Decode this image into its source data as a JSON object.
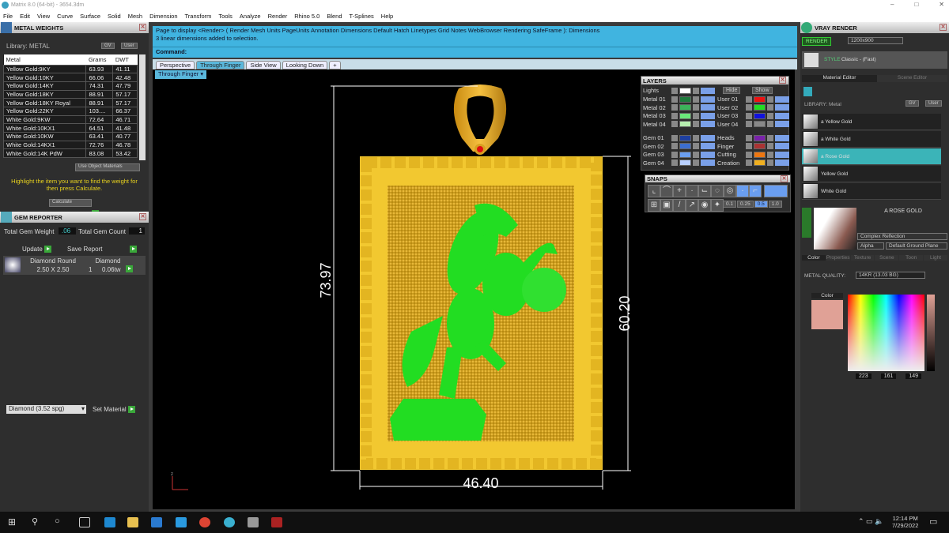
{
  "window": {
    "title": "Matrix 8.0 (64-bit) - 3654.3dm",
    "controls": [
      "–",
      "□",
      "✕"
    ]
  },
  "menu": [
    "File",
    "Edit",
    "View",
    "Curve",
    "Surface",
    "Solid",
    "Mesh",
    "Dimension",
    "Transform",
    "Tools",
    "Analyze",
    "Render",
    "Rhino 5.0",
    "Blend",
    "T-Splines",
    "Help"
  ],
  "metal_weights": {
    "title": "METAL WEIGHTS",
    "library_label": "Library: METAL",
    "gv": "GV",
    "user": "User",
    "columns": [
      "Metal",
      "Grams",
      "DWT"
    ],
    "rows": [
      [
        "Yellow Gold:9KY",
        "63.93",
        "41.11"
      ],
      [
        "Yellow Gold:10KY",
        "66.06",
        "42.48"
      ],
      [
        "Yellow Gold:14KY",
        "74.31",
        "47.79"
      ],
      [
        "Yellow Gold:18KY",
        "88.91",
        "57.17"
      ],
      [
        "Yellow Gold:18KY Royal",
        "88.91",
        "57.17"
      ],
      [
        "Yellow Gold:22KY",
        "103....",
        "66.37"
      ],
      [
        "White Gold:9KW",
        "72.64",
        "46.71"
      ],
      [
        "White Gold:10KX1",
        "64.51",
        "41.48"
      ],
      [
        "White Gold:10KW",
        "63.41",
        "40.77"
      ],
      [
        "White Gold:14KX1",
        "72.76",
        "46.78"
      ],
      [
        "White Gold:14K PdW",
        "83.08",
        "53.42"
      ]
    ],
    "use_object_materials": "Use Object Materials",
    "hint": "Highlight the item you want to find the weight for then press Calculate.",
    "calculate": "Calculate"
  },
  "gem_reporter": {
    "title": "GEM REPORTER",
    "total_weight_label": "Total Gem Weight",
    "total_weight": ".06",
    "total_count_label": "Total Gem Count",
    "total_count": "1",
    "update": "Update",
    "save_report": "Save Report",
    "gem": {
      "shape": "Diamond Round",
      "material": "Diamond",
      "size": "2.50 X 2.50",
      "count": "1",
      "weight": "0.06tw"
    },
    "material_select": "Diamond    (3.52 spg)",
    "set_material": "Set Material"
  },
  "command": {
    "history": [
      "Page to display <Render> ( Render  Mesh  Units  PageUnits  Annotation  Dimensions  Default  Hatch  Linetypes  Grid  Notes  WebBrowser  Rendering  SafeFrame ): Dimensions",
      "3 linear dimensions added to selection."
    ],
    "prompt": "Command:",
    "value": ""
  },
  "viewport_tabs": [
    {
      "label": "Perspective",
      "active": false
    },
    {
      "label": "Through Finger",
      "active": true
    },
    {
      "label": "Side View",
      "active": false
    },
    {
      "label": "Looking Down",
      "active": false
    },
    {
      "label": "+",
      "active": false
    }
  ],
  "viewport": {
    "name": "Through Finger",
    "dimensions": {
      "overall_height": "73.97",
      "body_height": "60.20",
      "width": "46.40"
    },
    "axis_label": "z"
  },
  "layers": {
    "title": "LAYERS",
    "lights": "Lights",
    "hide": "Hide",
    "show": "Show",
    "left": [
      {
        "name": "Metal 01",
        "color": "#1f7a3c"
      },
      {
        "name": "Metal 02",
        "color": "#3cb35a"
      },
      {
        "name": "Metal 03",
        "color": "#6ae87a"
      },
      {
        "name": "Metal 04",
        "color": "#b8f0b0"
      },
      {
        "name": "Gem 01",
        "color": "#1e3fa0"
      },
      {
        "name": "Gem 02",
        "color": "#3c6ed0"
      },
      {
        "name": "Gem 03",
        "color": "#6a9ef0"
      },
      {
        "name": "Gem 04",
        "color": "#b8d0ff"
      }
    ],
    "right": [
      {
        "name": "User 01",
        "color": "#ee1111"
      },
      {
        "name": "User 02",
        "color": "#22dd22"
      },
      {
        "name": "User 03",
        "color": "#1111dd"
      },
      {
        "name": "User 04",
        "color": "#888888"
      },
      {
        "name": "Heads",
        "color": "#7a22aa"
      },
      {
        "name": "Finger",
        "color": "#aa3333"
      },
      {
        "name": "Cutting",
        "color": "#ee7711"
      },
      {
        "name": "Creation",
        "color": "#f0b020"
      }
    ]
  },
  "snaps": {
    "title": "SNAPS",
    "values": [
      "0.1",
      "0.25",
      "0.5",
      "1.0"
    ],
    "selected": "0.5"
  },
  "vray": {
    "title": "VRAY RENDER",
    "render": "RENDER",
    "resolution": "1200x900",
    "style_label": "STYLE",
    "style": "Classic - (Fast)",
    "tabs": [
      "Material Editor",
      "Scene Editor"
    ],
    "library_label": "LIBRARY: Metal",
    "gv": "GV",
    "user": "User",
    "materials": [
      {
        "name": "a Yellow Gold",
        "selected": false
      },
      {
        "name": "a White Gold",
        "selected": false
      },
      {
        "name": "a Rose Gold",
        "selected": true
      },
      {
        "name": "Yellow Gold",
        "selected": false
      },
      {
        "name": "White Gold",
        "selected": false
      }
    ],
    "current": "A ROSE GOLD",
    "reflection": "Complex Reflection",
    "alpha": "Alpha",
    "ground": "Default Ground Plane",
    "prop_tabs": [
      "Color",
      "Properties",
      "Texture",
      "Scene",
      "Toon",
      "Light"
    ],
    "metal_quality_label": "METAL QUALITY:",
    "metal_quality": "14KR        (13.03 BG)",
    "color_label": "Color",
    "swatch": "#e0a196",
    "rgb": [
      "223",
      "161",
      "149"
    ]
  },
  "taskbar": {
    "time": "12:14 PM",
    "date": "7/29/2022"
  }
}
